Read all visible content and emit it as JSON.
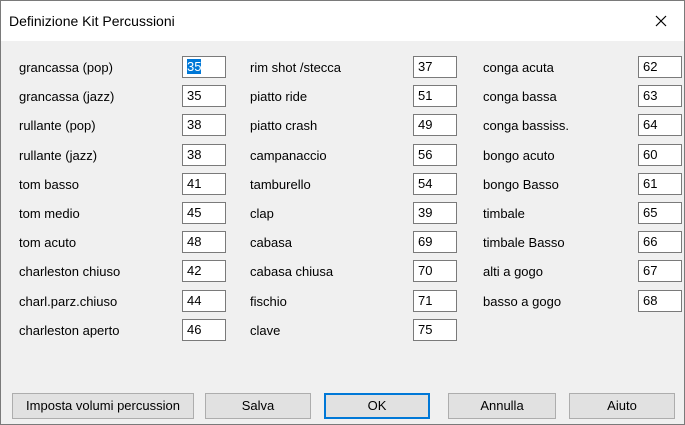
{
  "window": {
    "title": "Definizione Kit Percussioni"
  },
  "columns": [
    {
      "items": [
        {
          "label": "grancassa (pop)",
          "value": "35",
          "selected": true
        },
        {
          "label": "grancassa (jazz)",
          "value": "35"
        },
        {
          "label": "rullante (pop)",
          "value": "38"
        },
        {
          "label": "rullante (jazz)",
          "value": "38"
        },
        {
          "label": "tom basso",
          "value": "41"
        },
        {
          "label": "tom medio",
          "value": "45"
        },
        {
          "label": "tom acuto",
          "value": "48"
        },
        {
          "label": "charleston chiuso",
          "value": "42"
        },
        {
          "label": "charl.parz.chiuso",
          "value": "44"
        },
        {
          "label": "charleston aperto",
          "value": "46"
        }
      ]
    },
    {
      "items": [
        {
          "label": "rim shot /stecca",
          "value": "37"
        },
        {
          "label": "piatto ride",
          "value": "51"
        },
        {
          "label": "piatto crash",
          "value": "49"
        },
        {
          "label": "campanaccio",
          "value": "56"
        },
        {
          "label": "tamburello",
          "value": "54"
        },
        {
          "label": "clap",
          "value": "39"
        },
        {
          "label": "cabasa",
          "value": "69"
        },
        {
          "label": "cabasa chiusa",
          "value": "70"
        },
        {
          "label": "fischio",
          "value": "71"
        },
        {
          "label": "clave",
          "value": "75"
        }
      ]
    },
    {
      "items": [
        {
          "label": "conga acuta",
          "value": "62"
        },
        {
          "label": "conga bassa",
          "value": "63"
        },
        {
          "label": "conga bassiss.",
          "value": "64"
        },
        {
          "label": "bongo acuto",
          "value": "60"
        },
        {
          "label": "bongo Basso",
          "value": "61"
        },
        {
          "label": "timbale",
          "value": "65"
        },
        {
          "label": "timbale Basso",
          "value": "66"
        },
        {
          "label": "alti a gogo",
          "value": "67"
        },
        {
          "label": "basso a gogo",
          "value": "68"
        }
      ]
    }
  ],
  "buttons": {
    "set_volumes": "Imposta volumi percussion",
    "save": "Salva",
    "ok": "OK",
    "cancel": "Annulla",
    "help": "Aiuto"
  },
  "icons": {
    "close": "close-icon"
  }
}
